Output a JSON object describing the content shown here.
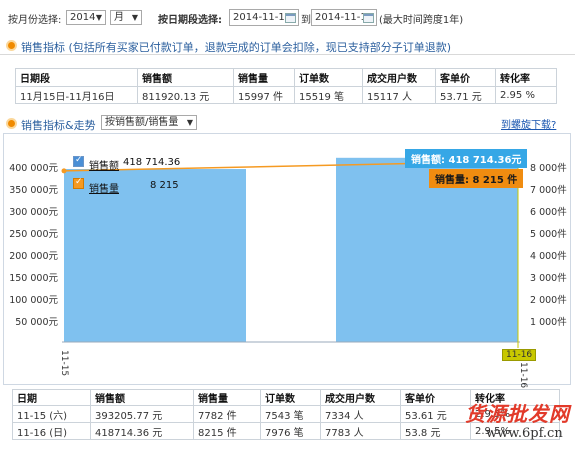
{
  "filter": {
    "month_label": "按月份选择:",
    "year_value": "2014",
    "month_value": "月",
    "period_label": "按日期段选择:",
    "start_date": "2014-11-15",
    "to_label": "到",
    "end_date": "2014-11-16",
    "range_note": "(最大时间跨度1年)"
  },
  "summary": {
    "title": "销售指标 (包括所有买家已付款订单，退款完成的订单会扣除，现已支持部分子订单退款)",
    "headers": [
      "日期段",
      "销售额",
      "销售量",
      "订单数",
      "成交用户数",
      "客单价",
      "转化率"
    ],
    "row": [
      "11月15日-11月16日",
      "811920.13 元",
      "15997 件",
      "15519 笔",
      "15117 人",
      "53.71 元",
      "2.95 %"
    ]
  },
  "trend": {
    "title": "销售指标&走势",
    "select_value": "按销售额/销售量",
    "download_link": "到螺旋下载?"
  },
  "chart_data": {
    "type": "bar",
    "categories": [
      "11-15",
      "11-16"
    ],
    "series": [
      {
        "name": "销售额",
        "values": [
          393205.77,
          418714.36
        ],
        "color": "#7fc1ef"
      },
      {
        "name": "销售量",
        "values": [
          7782,
          8215
        ],
        "color": "#f59a22"
      }
    ],
    "y_left_ticks": [
      "400 000元",
      "350 000元",
      "300 000元",
      "250 000元",
      "200 000元",
      "150 000元",
      "100 000元",
      "50 000元"
    ],
    "y_left_ticks_values": [
      400000,
      350000,
      300000,
      250000,
      200000,
      150000,
      100000,
      50000
    ],
    "y_right_ticks": [
      "8 000件",
      "7 000件",
      "6 000件",
      "5 000件",
      "4 000件",
      "3 000件",
      "2 000件",
      "1 000件"
    ],
    "y_right_ticks_values": [
      8000,
      7000,
      6000,
      5000,
      4000,
      3000,
      2000,
      1000
    ],
    "ylim_left": [
      0,
      441000
    ],
    "ylim_right": [
      0,
      8820
    ],
    "legend": [
      {
        "label": "销售额",
        "value": "418 714.36"
      },
      {
        "label": "销售量",
        "value": "8 215"
      }
    ],
    "tooltips": [
      "销售额: 418 714.36元",
      "销售量: 8 215 件"
    ],
    "x_labels": [
      "11-15",
      "11-16"
    ]
  },
  "detail": {
    "headers": [
      "日期",
      "销售额",
      "销售量",
      "订单数",
      "成交用户数",
      "客单价",
      "转化率"
    ],
    "rows": [
      [
        "11-15 (六)",
        "393205.77 元",
        "7782 件",
        "7543 笔",
        "7334 人",
        "53.61 元",
        "2.9.5%"
      ],
      [
        "11-16 (日)",
        "418714.36 元",
        "8215 件",
        "7976 笔",
        "7783 人",
        "53.8 元",
        "2.9.5%"
      ]
    ]
  },
  "watermark": {
    "line1": "货源批发网",
    "line2": "www.6pf.cn"
  }
}
